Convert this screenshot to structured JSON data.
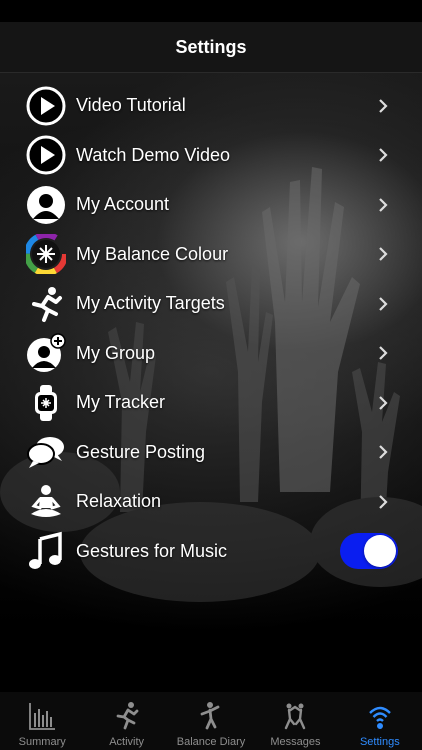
{
  "header": {
    "title": "Settings"
  },
  "settings_items": [
    {
      "label": "Video Tutorial",
      "icon": "play-circle-icon"
    },
    {
      "label": "Watch Demo Video",
      "icon": "play-circle-icon"
    },
    {
      "label": "My Account",
      "icon": "user-silhouette-icon"
    },
    {
      "label": "My Balance Colour",
      "icon": "colour-wheel-icon"
    },
    {
      "label": "My Activity Targets",
      "icon": "running-person-icon"
    },
    {
      "label": "My Group",
      "icon": "add-user-icon"
    },
    {
      "label": "My Tracker",
      "icon": "watch-icon"
    },
    {
      "label": "Gesture Posting",
      "icon": "chat-bubbles-icon"
    },
    {
      "label": "Relaxation",
      "icon": "meditation-icon"
    },
    {
      "label": "Gestures for Music",
      "icon": "music-note-icon",
      "toggle_on": true
    }
  ],
  "tabs": [
    {
      "label": "Summary",
      "icon": "bar-chart-icon",
      "active": false
    },
    {
      "label": "Activity",
      "icon": "runner-icon",
      "active": false
    },
    {
      "label": "Balance Diary",
      "icon": "balance-figure-icon",
      "active": false
    },
    {
      "label": "Messages",
      "icon": "dancers-icon",
      "active": false
    },
    {
      "label": "Settings",
      "icon": "wireless-settings-icon",
      "active": true
    }
  ],
  "colors": {
    "accent": "#2f8cff",
    "toggle_on": "#0a1ef0",
    "background": "#000000"
  }
}
